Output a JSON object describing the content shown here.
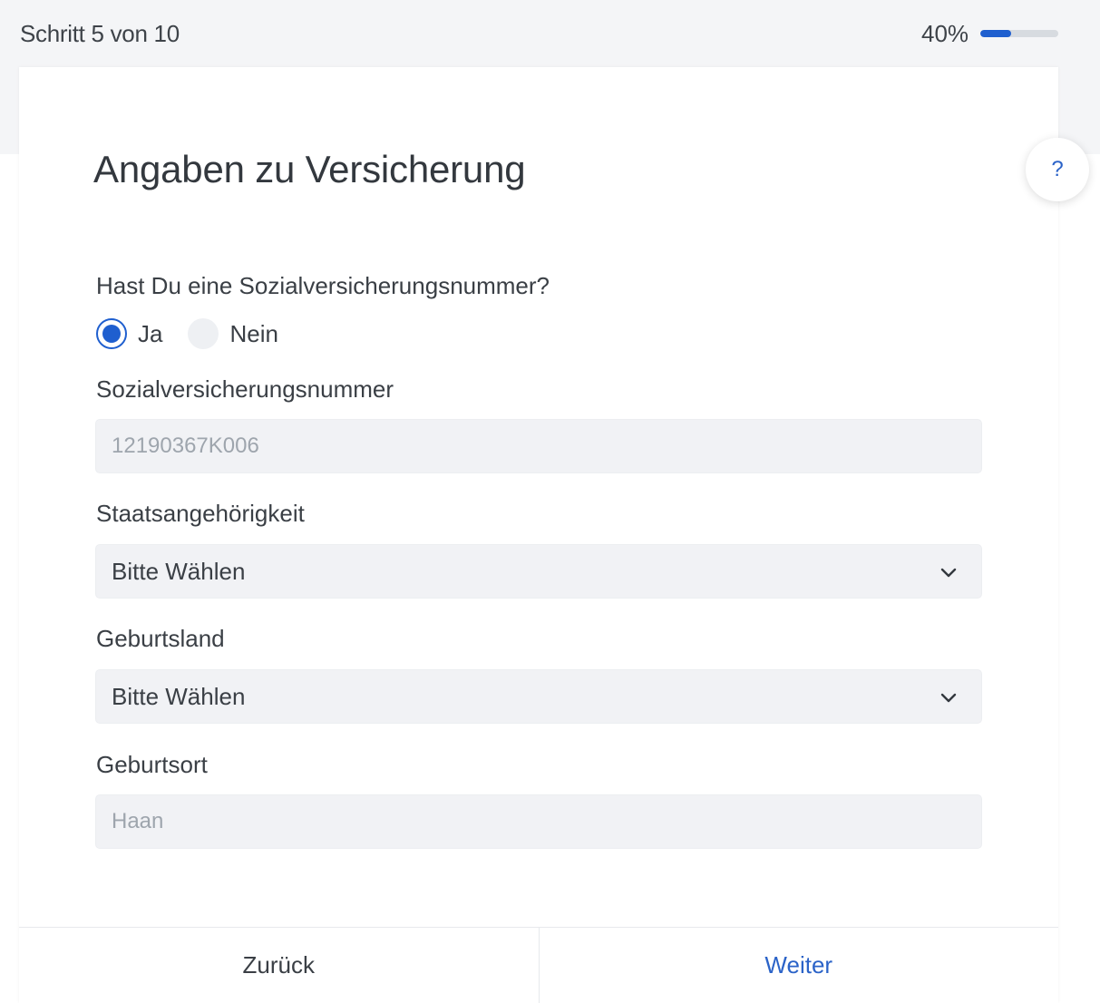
{
  "progress": {
    "step_label": "Schritt 5 von 10",
    "percent_label": "40%",
    "fraction": 0.4
  },
  "help": {
    "label": "?"
  },
  "form": {
    "title": "Angaben zu Versicherung",
    "sv_question": "Hast Du eine Sozialversicherungsnummer?",
    "radio_yes": "Ja",
    "radio_no": "Nein",
    "radio_selected": "Ja",
    "sv_label": "Sozialversicherungsnummer",
    "sv_value": "12190367K006",
    "nationality_label": "Staatsangehörigkeit",
    "nationality_value": "Bitte Wählen",
    "birth_country_label": "Geburtsland",
    "birth_country_value": "Bitte Wählen",
    "birth_place_label": "Geburtsort",
    "birth_place_value": "Haan"
  },
  "footer": {
    "back_label": "Zurück",
    "next_label": "Weiter"
  },
  "colors": {
    "accent": "#1f5fcf",
    "link": "#2b63c8",
    "field_bg": "#f1f2f5"
  },
  "icons": {
    "help": "question-icon",
    "select": "chevron-down-icon"
  }
}
